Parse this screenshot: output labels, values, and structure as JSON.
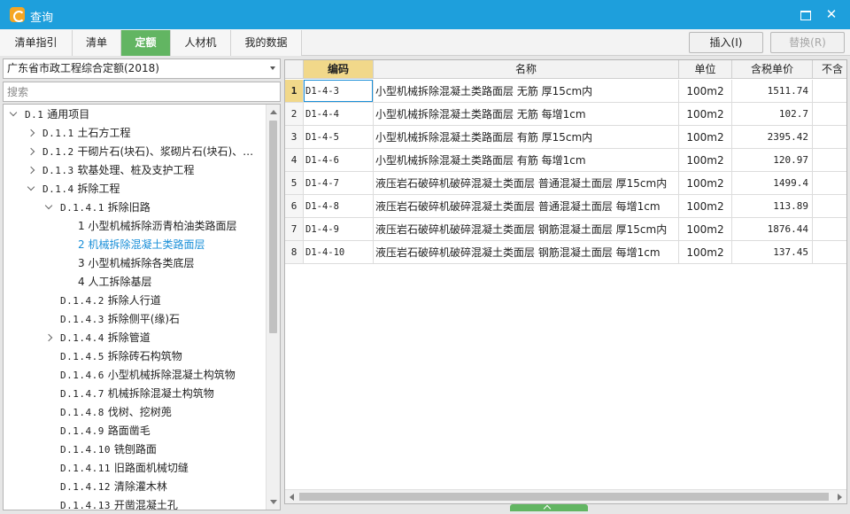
{
  "window": {
    "title": "查询"
  },
  "tabs": [
    {
      "label": "清单指引",
      "active": false
    },
    {
      "label": "清单",
      "active": false
    },
    {
      "label": "定额",
      "active": true
    },
    {
      "label": "人材机",
      "active": false
    },
    {
      "label": "我的数据",
      "active": false
    }
  ],
  "toolbar": {
    "insert_label": "插入(I)",
    "replace_label": "替换(R)"
  },
  "left": {
    "library_selected": "广东省市政工程综合定额(2018)",
    "search_placeholder": "搜索",
    "tree": [
      {
        "code": "D.1",
        "label": "通用项目",
        "expanded": true
      },
      {
        "code": "D.1.1",
        "label": "土石方工程",
        "expanded": false
      },
      {
        "code": "D.1.2",
        "label": "干砌片石(块石)、浆砌片石(块石)、…",
        "expanded": false
      },
      {
        "code": "D.1.3",
        "label": "软基处理、桩及支护工程",
        "expanded": false
      },
      {
        "code": "D.1.4",
        "label": "拆除工程",
        "expanded": true
      },
      {
        "code": "D.1.4.1",
        "label": "拆除旧路",
        "expanded": true
      },
      {
        "code": "1",
        "label": "小型机械拆除沥青柏油类路面层"
      },
      {
        "code": "2",
        "label": "机械拆除混凝土类路面层",
        "selected": true
      },
      {
        "code": "3",
        "label": "小型机械拆除各类底层"
      },
      {
        "code": "4",
        "label": "人工拆除基层"
      },
      {
        "code": "D.1.4.2",
        "label": "拆除人行道"
      },
      {
        "code": "D.1.4.3",
        "label": "拆除侧平(缘)石"
      },
      {
        "code": "D.1.4.4",
        "label": "拆除管道",
        "expanded": false
      },
      {
        "code": "D.1.4.5",
        "label": "拆除砖石构筑物"
      },
      {
        "code": "D.1.4.6",
        "label": "小型机械拆除混凝土构筑物"
      },
      {
        "code": "D.1.4.7",
        "label": "机械拆除混凝土构筑物"
      },
      {
        "code": "D.1.4.8",
        "label": "伐树、挖树蔸"
      },
      {
        "code": "D.1.4.9",
        "label": "路面凿毛"
      },
      {
        "code": "D.1.4.10",
        "label": "铣刨路面"
      },
      {
        "code": "D.1.4.11",
        "label": "旧路面机械切缝"
      },
      {
        "code": "D.1.4.12",
        "label": "清除灌木林"
      },
      {
        "code": "D.1.4.13",
        "label": "开凿混凝土孔"
      }
    ]
  },
  "grid": {
    "columns": [
      "编码",
      "名称",
      "单位",
      "含税单价",
      "不含"
    ],
    "rows": [
      {
        "no": "1",
        "code": "D1-4-3",
        "name": "小型机械拆除混凝土类路面层 无筋 厚15cm内",
        "unit": "100m2",
        "price": "1511.74"
      },
      {
        "no": "2",
        "code": "D1-4-4",
        "name": "小型机械拆除混凝土类路面层 无筋 每增1cm",
        "unit": "100m2",
        "price": "102.7"
      },
      {
        "no": "3",
        "code": "D1-4-5",
        "name": "小型机械拆除混凝土类路面层 有筋 厚15cm内",
        "unit": "100m2",
        "price": "2395.42"
      },
      {
        "no": "4",
        "code": "D1-4-6",
        "name": "小型机械拆除混凝土类路面层 有筋 每增1cm",
        "unit": "100m2",
        "price": "120.97"
      },
      {
        "no": "5",
        "code": "D1-4-7",
        "name": "液压岩石破碎机破碎混凝土类面层 普通混凝土面层 厚15cm内",
        "unit": "100m2",
        "price": "1499.4"
      },
      {
        "no": "6",
        "code": "D1-4-8",
        "name": "液压岩石破碎机破碎混凝土类面层 普通混凝土面层 每增1cm",
        "unit": "100m2",
        "price": "113.89"
      },
      {
        "no": "7",
        "code": "D1-4-9",
        "name": "液压岩石破碎机破碎混凝土类面层 钢筋混凝土面层 厚15cm内",
        "unit": "100m2",
        "price": "1876.44"
      },
      {
        "no": "8",
        "code": "D1-4-10",
        "name": "液压岩石破碎机破碎混凝土类面层 钢筋混凝土面层 每增1cm",
        "unit": "100m2",
        "price": "137.45"
      }
    ]
  },
  "colors": {
    "titlebar": "#1e9fdc",
    "active_tab": "#62b562",
    "code_header": "#f1d88a",
    "selected_tree": "#1a8fd8"
  }
}
